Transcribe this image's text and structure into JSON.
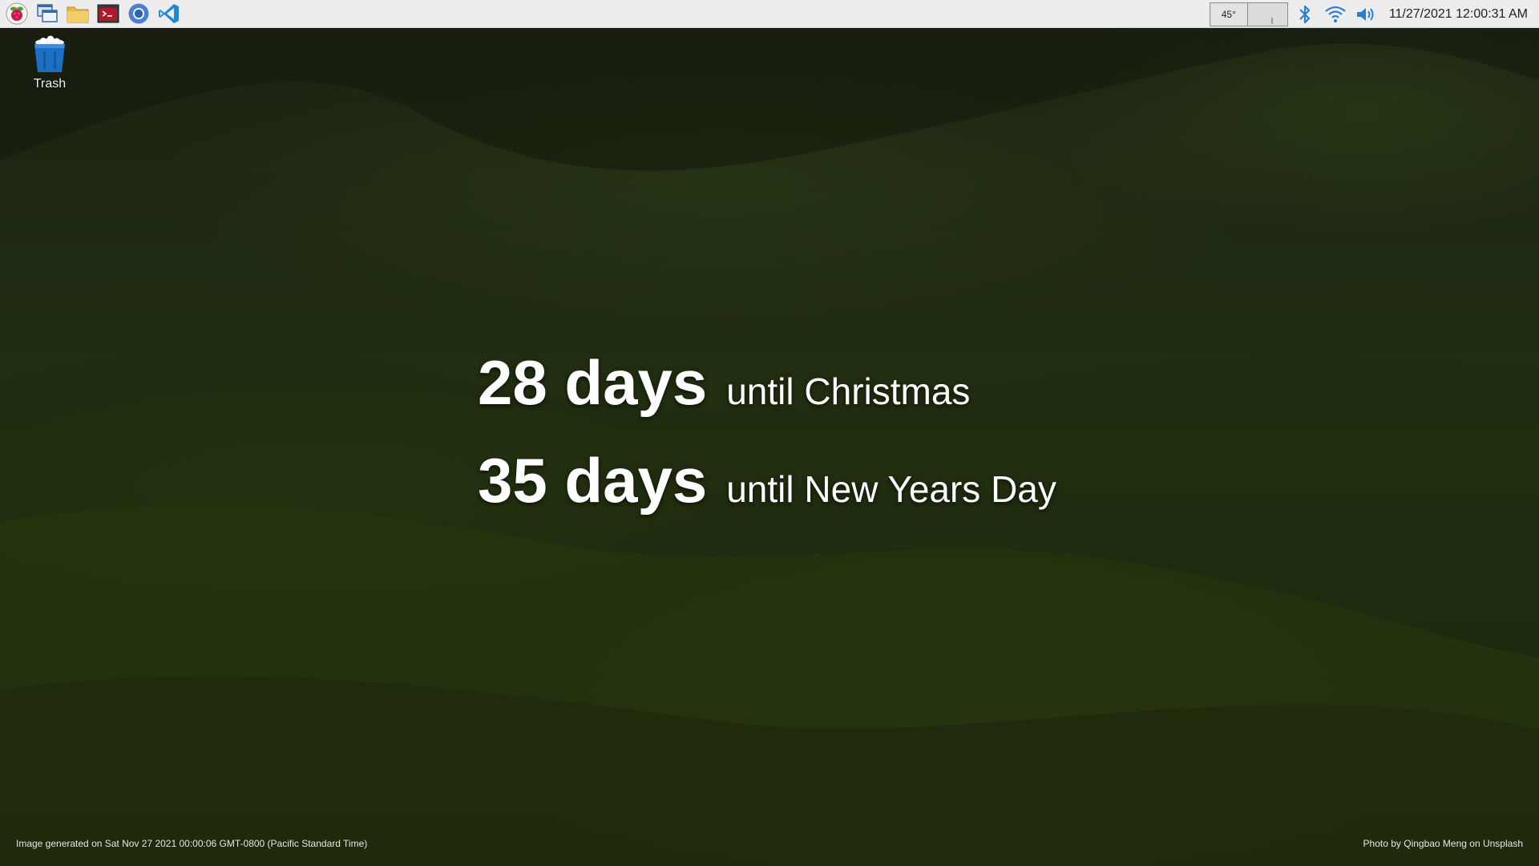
{
  "taskbar": {
    "launchers": [
      {
        "name": "raspberry-menu-icon"
      },
      {
        "name": "window-switcher-icon"
      },
      {
        "name": "file-manager-icon"
      },
      {
        "name": "terminal-icon"
      },
      {
        "name": "chromium-icon"
      },
      {
        "name": "vscode-icon"
      }
    ],
    "cpu_temp": "45°",
    "clock": "11/27/2021 12:00:31 AM"
  },
  "desktop": {
    "trash_label": "Trash"
  },
  "countdown": [
    {
      "days": "28 days",
      "label": "until Christmas"
    },
    {
      "days": "35 days",
      "label": "until New Years Day"
    }
  ],
  "footer": {
    "generated": "Image generated on Sat Nov 27 2021 00:00:06 GMT-0800 (Pacific Standard Time)",
    "credit": "Photo by Qingbao Meng on Unsplash"
  },
  "colors": {
    "taskbar_bg": "#ededed",
    "accent_blue": "#2a7fd4",
    "background": "#1f2a12"
  }
}
